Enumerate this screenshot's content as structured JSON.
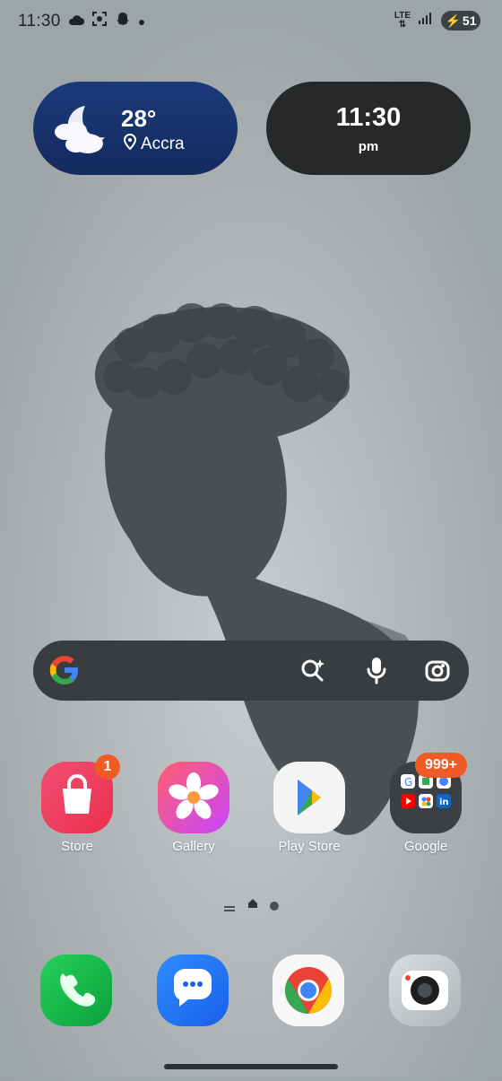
{
  "status_bar": {
    "time": "11:30",
    "network": "LTE",
    "battery": "51",
    "icons": [
      "cloud-icon",
      "screenshot-icon",
      "snapchat-icon",
      "dot-icon",
      "signal-icon",
      "battery-icon"
    ]
  },
  "weather_widget": {
    "temperature": "28°",
    "location": "Accra",
    "icon": "moon-cloud-icon"
  },
  "clock_widget": {
    "time": "11:30",
    "ampm": "pm"
  },
  "search_bar": {
    "icons": [
      "google-icon",
      "ai-search-icon",
      "microphone-icon",
      "lens-icon"
    ]
  },
  "home_apps": [
    {
      "label": "Store",
      "badge": "1"
    },
    {
      "label": "Gallery",
      "badge": ""
    },
    {
      "label": "Play Store",
      "badge": ""
    },
    {
      "label": "Google",
      "badge": "999+"
    }
  ],
  "dock": {
    "apps": [
      "phone-icon",
      "messages-icon",
      "chrome-icon",
      "camera-icon"
    ]
  },
  "colors": {
    "weather_bg": "#1b3a7a",
    "clock_bg": "#262829",
    "badge": "#ef5a25",
    "search_bg": "#3a3d3f"
  }
}
